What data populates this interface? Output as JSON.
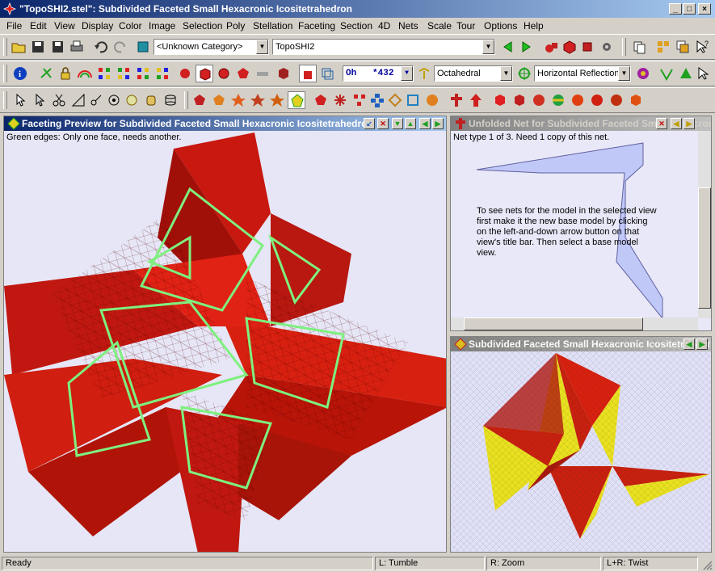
{
  "window": {
    "title": "\"TopoSHI2.stel\": Subdivided Faceted Small Hexacronic Icositetrahedron"
  },
  "menu": [
    "File",
    "Edit",
    "View",
    "Display",
    "Color",
    "Image",
    "Selection",
    "Poly",
    "Stellation",
    "Faceting",
    "Section",
    "4D",
    "Nets",
    "Scale",
    "Tour",
    "Options",
    "Help"
  ],
  "toolbar1": {
    "category": "<Unknown Category>",
    "model": "TopoSHI2"
  },
  "toolbar2": {
    "symmetry": "Oh",
    "count": "*432",
    "symmetry_type": "Octahedral",
    "reflection": "Horizontal Reflection"
  },
  "panes": {
    "faceting": {
      "title": "Faceting Preview for Subdivided Faceted Small Hexacronic Icositetrahedron",
      "note": "Green edges: Only one face, needs another."
    },
    "net": {
      "title": "Unfolded Net for Subdivided Faceted Small Hexacronic Icositetrahedron",
      "info": "Net type 1 of 3.  Need 1 copy of this net.",
      "instructions": "To see nets for the model in the selected view first make it the new base model by clicking on the left-and-down arrow button on that view's title bar.  Then select a base model view."
    },
    "model": {
      "title": "Subdivided Faceted Small Hexacronic Icositetrahedron"
    }
  },
  "status": {
    "ready": "Ready",
    "left": "L: Tumble",
    "right": "R: Zoom",
    "both": "L+R: Twist"
  },
  "colors": {
    "title_active": "#0a246a",
    "pane_bg": "#e8e8f8",
    "model_red": "#d42010",
    "model_yellow": "#e8e020",
    "edge_green": "#7ef07e",
    "net_fill": "#c0c8f8"
  }
}
